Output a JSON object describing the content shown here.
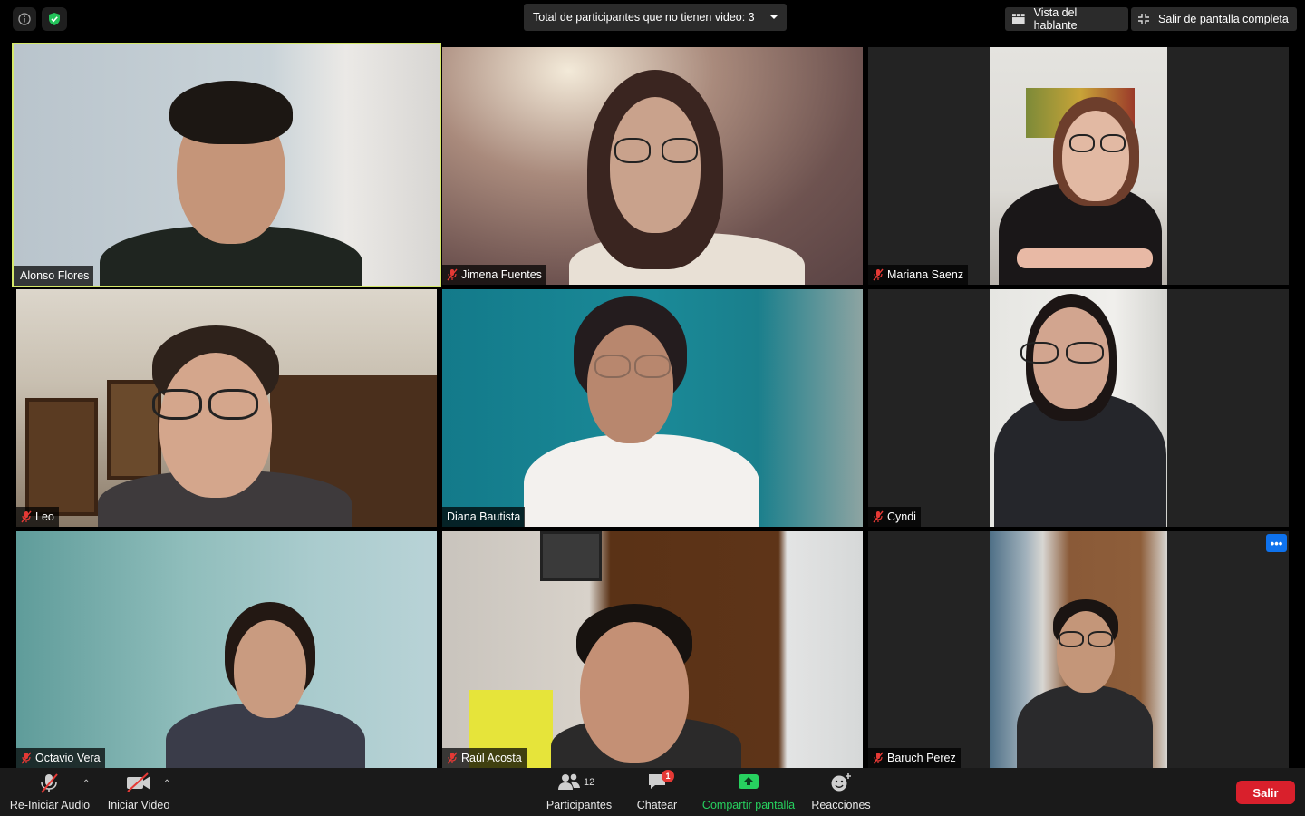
{
  "topbar": {
    "no_video_label": "Total de participantes que no tienen video: 3",
    "speaker_view_label": "Vista del hablante",
    "exit_fullscreen_label": "Salir de pantalla completa"
  },
  "participants": [
    {
      "name": "Alonso Flores",
      "muted": false,
      "active_speaker": true
    },
    {
      "name": "Jimena Fuentes",
      "muted": true,
      "active_speaker": false
    },
    {
      "name": "Mariana Saenz",
      "muted": true,
      "active_speaker": false
    },
    {
      "name": "Leo",
      "muted": true,
      "active_speaker": false
    },
    {
      "name": "Diana Bautista",
      "muted": false,
      "active_speaker": false
    },
    {
      "name": "Cyndi",
      "muted": true,
      "active_speaker": false
    },
    {
      "name": "Octavio Vera",
      "muted": true,
      "active_speaker": false
    },
    {
      "name": "Raúl Acosta",
      "muted": true,
      "active_speaker": false
    },
    {
      "name": "Baruch Perez",
      "muted": true,
      "active_speaker": false
    }
  ],
  "tile_overlay": {
    "more_label": "•••"
  },
  "toolbar": {
    "audio_label": "Re-Iniciar Audio",
    "video_label": "Iniciar Video",
    "participants_label": "Participantes",
    "participants_count": "12",
    "chat_label": "Chatear",
    "chat_badge": "1",
    "share_label": "Compartir pantalla",
    "reactions_label": "Reacciones",
    "leave_label": "Salir"
  },
  "colors": {
    "active_speaker_border": "#d5e86a",
    "share_green": "#27d15f",
    "leave_red": "#d9202c",
    "muted_mic_red": "#e53935",
    "more_button_blue": "#0e72ed"
  },
  "icons": [
    "info-icon",
    "shield-check-icon",
    "speaker-view-icon",
    "exit-fullscreen-icon",
    "muted-mic-icon",
    "video-off-icon",
    "participants-icon",
    "chat-icon",
    "share-screen-icon",
    "reactions-icon",
    "more-options-icon"
  ]
}
